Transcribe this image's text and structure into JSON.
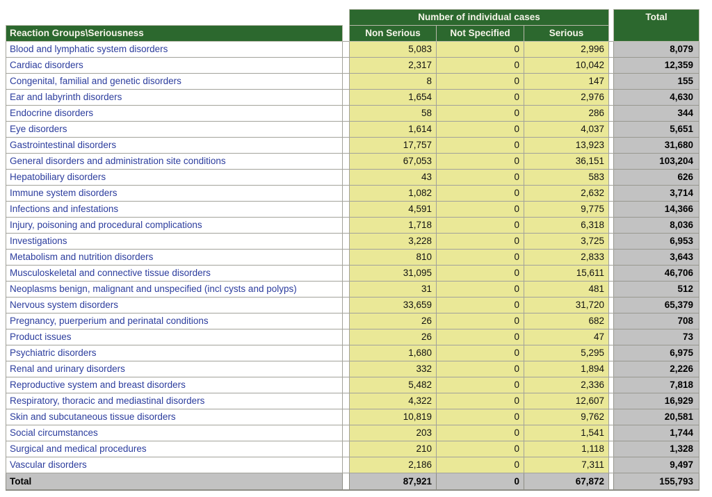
{
  "table": {
    "group_header": "Number of individual cases",
    "corner_header": "Reaction Groups\\Seriousness",
    "columns": [
      "Non Serious",
      "Not Specified",
      "Serious"
    ],
    "total_header": "Total",
    "rows": [
      {
        "label": "Blood and lymphatic system disorders",
        "values": [
          "5,083",
          "0",
          "2,996"
        ],
        "total": "8,079"
      },
      {
        "label": "Cardiac disorders",
        "values": [
          "2,317",
          "0",
          "10,042"
        ],
        "total": "12,359"
      },
      {
        "label": "Congenital, familial and genetic disorders",
        "values": [
          "8",
          "0",
          "147"
        ],
        "total": "155"
      },
      {
        "label": "Ear and labyrinth disorders",
        "values": [
          "1,654",
          "0",
          "2,976"
        ],
        "total": "4,630"
      },
      {
        "label": "Endocrine disorders",
        "values": [
          "58",
          "0",
          "286"
        ],
        "total": "344"
      },
      {
        "label": "Eye disorders",
        "values": [
          "1,614",
          "0",
          "4,037"
        ],
        "total": "5,651"
      },
      {
        "label": "Gastrointestinal disorders",
        "values": [
          "17,757",
          "0",
          "13,923"
        ],
        "total": "31,680"
      },
      {
        "label": "General disorders and administration site conditions",
        "values": [
          "67,053",
          "0",
          "36,151"
        ],
        "total": "103,204"
      },
      {
        "label": "Hepatobiliary disorders",
        "values": [
          "43",
          "0",
          "583"
        ],
        "total": "626"
      },
      {
        "label": "Immune system disorders",
        "values": [
          "1,082",
          "0",
          "2,632"
        ],
        "total": "3,714"
      },
      {
        "label": "Infections and infestations",
        "values": [
          "4,591",
          "0",
          "9,775"
        ],
        "total": "14,366"
      },
      {
        "label": "Injury, poisoning and procedural complications",
        "values": [
          "1,718",
          "0",
          "6,318"
        ],
        "total": "8,036"
      },
      {
        "label": "Investigations",
        "values": [
          "3,228",
          "0",
          "3,725"
        ],
        "total": "6,953"
      },
      {
        "label": "Metabolism and nutrition disorders",
        "values": [
          "810",
          "0",
          "2,833"
        ],
        "total": "3,643"
      },
      {
        "label": "Musculoskeletal and connective tissue disorders",
        "values": [
          "31,095",
          "0",
          "15,611"
        ],
        "total": "46,706"
      },
      {
        "label": "Neoplasms benign, malignant and unspecified (incl cysts and polyps)",
        "values": [
          "31",
          "0",
          "481"
        ],
        "total": "512"
      },
      {
        "label": "Nervous system disorders",
        "values": [
          "33,659",
          "0",
          "31,720"
        ],
        "total": "65,379"
      },
      {
        "label": "Pregnancy, puerperium and perinatal conditions",
        "values": [
          "26",
          "0",
          "682"
        ],
        "total": "708"
      },
      {
        "label": "Product issues",
        "values": [
          "26",
          "0",
          "47"
        ],
        "total": "73"
      },
      {
        "label": "Psychiatric disorders",
        "values": [
          "1,680",
          "0",
          "5,295"
        ],
        "total": "6,975"
      },
      {
        "label": "Renal and urinary disorders",
        "values": [
          "332",
          "0",
          "1,894"
        ],
        "total": "2,226"
      },
      {
        "label": "Reproductive system and breast disorders",
        "values": [
          "5,482",
          "0",
          "2,336"
        ],
        "total": "7,818"
      },
      {
        "label": "Respiratory, thoracic and mediastinal disorders",
        "values": [
          "4,322",
          "0",
          "12,607"
        ],
        "total": "16,929"
      },
      {
        "label": "Skin and subcutaneous tissue disorders",
        "values": [
          "10,819",
          "0",
          "9,762"
        ],
        "total": "20,581"
      },
      {
        "label": "Social circumstances",
        "values": [
          "203",
          "0",
          "1,541"
        ],
        "total": "1,744"
      },
      {
        "label": "Surgical and medical procedures",
        "values": [
          "210",
          "0",
          "1,118"
        ],
        "total": "1,328"
      },
      {
        "label": "Vascular disorders",
        "values": [
          "2,186",
          "0",
          "7,311"
        ],
        "total": "9,497"
      }
    ],
    "total_row": {
      "label": "Total",
      "values": [
        "87,921",
        "0",
        "67,872"
      ],
      "total": "155,793"
    }
  },
  "colors": {
    "header_green": "#2c682e",
    "data_yellow": "#eae897",
    "total_gray": "#c2c2c2",
    "label_blue": "#2b3c9d"
  }
}
